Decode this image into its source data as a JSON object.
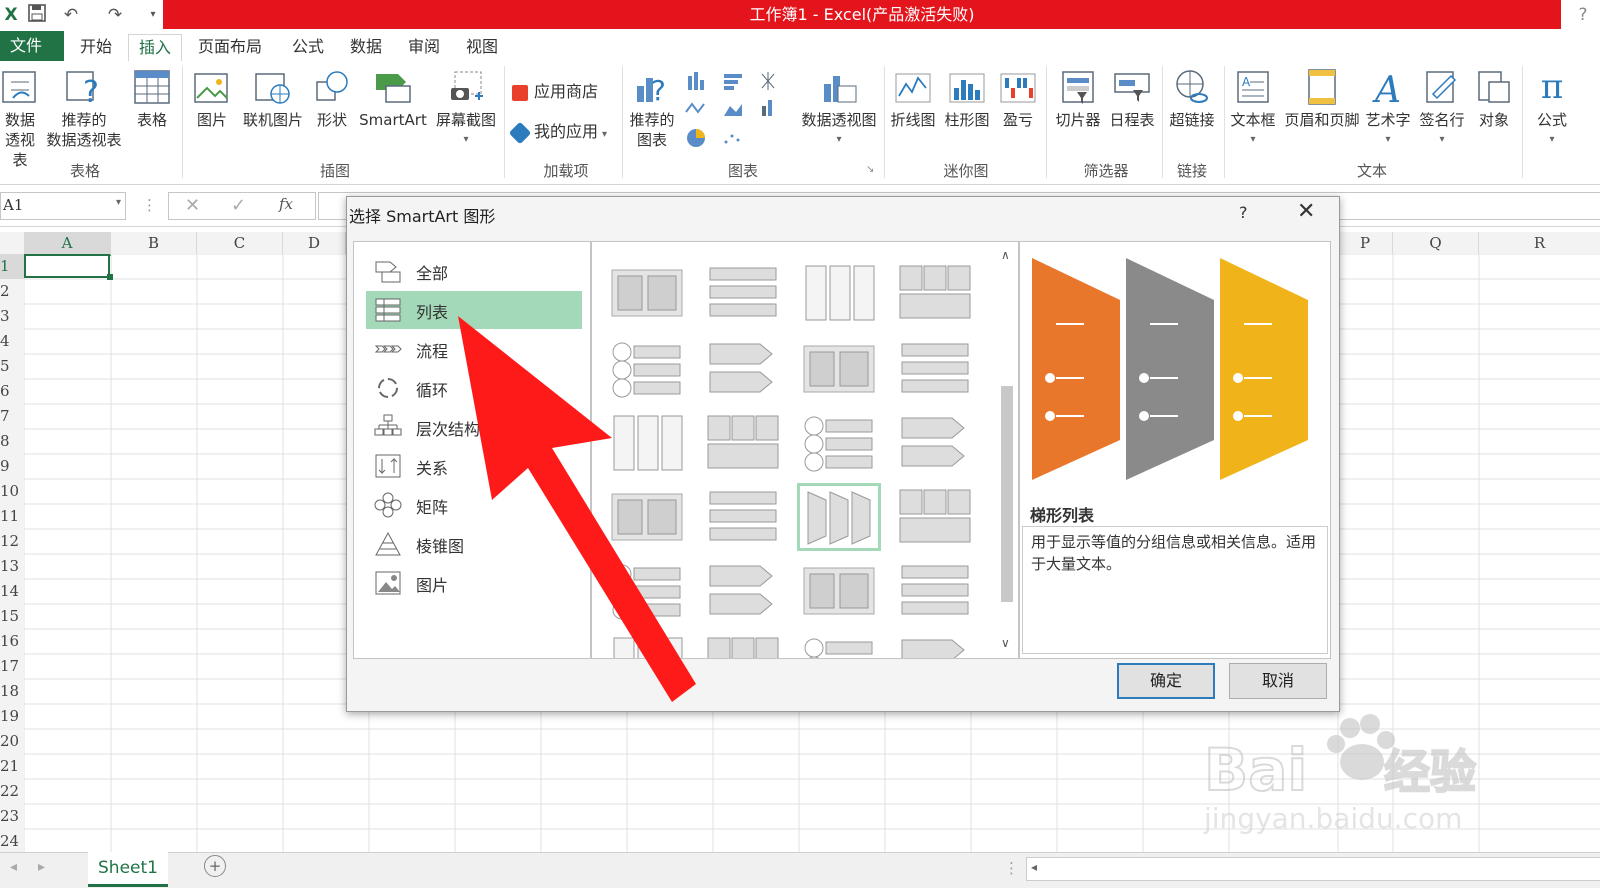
{
  "app": {
    "title": "工作簿1 - Excel(产品激活失败)",
    "help": "?"
  },
  "tabs": [
    "文件",
    "开始",
    "插入",
    "页面布局",
    "公式",
    "数据",
    "审阅",
    "视图"
  ],
  "ribbon": {
    "tables_group": {
      "label": "表格",
      "btn1_a": "数据",
      "btn1_b": "透视表",
      "btn2_a": "推荐的",
      "btn2_b": "数据透视表",
      "btn3": "表格"
    },
    "illustrations_group": {
      "label": "插图",
      "picture": "图片",
      "online_picture": "联机图片",
      "shapes": "形状",
      "smartart": "SmartArt",
      "screenshot": "屏幕截图"
    },
    "addins_group": {
      "label": "加载项",
      "store": "应用商店",
      "my_apps": "我的应用"
    },
    "charts_group": {
      "label": "图表",
      "recommended_a": "推荐的",
      "recommended_b": "图表",
      "pivot_chart": "数据透视图"
    },
    "sparklines_group": {
      "label": "迷你图",
      "line": "折线图",
      "column": "柱形图",
      "win_loss": "盈亏"
    },
    "filters_group": {
      "label": "筛选器",
      "slicer": "切片器",
      "timeline": "日程表"
    },
    "links_group": {
      "label": "链接",
      "hyperlink": "超链接"
    },
    "text_group": {
      "label": "文本",
      "textbox": "文本框",
      "header_footer": "页眉和页脚",
      "wordart": "艺术字",
      "signature": "签名行",
      "object": "对象"
    },
    "symbols_group": {
      "equation": "公式"
    }
  },
  "formula_bar": {
    "name_box": "A1",
    "fx": "fx"
  },
  "columns": [
    "A",
    "B",
    "C",
    "D",
    "P",
    "Q",
    "R"
  ],
  "rows": [
    "1",
    "2",
    "3",
    "4",
    "5",
    "6",
    "7",
    "8",
    "9",
    "10",
    "11",
    "12",
    "13",
    "14",
    "15",
    "16",
    "17",
    "18",
    "19",
    "20",
    "21",
    "22",
    "23",
    "24"
  ],
  "sheet": {
    "tab": "Sheet1"
  },
  "dialog": {
    "title": "选择 SmartArt 图形",
    "help": "?",
    "categories": [
      {
        "label": "全部",
        "icon": "all-icon"
      },
      {
        "label": "列表",
        "icon": "list-icon"
      },
      {
        "label": "流程",
        "icon": "process-icon"
      },
      {
        "label": "循环",
        "icon": "cycle-icon"
      },
      {
        "label": "层次结构",
        "icon": "hierarchy-icon"
      },
      {
        "label": "关系",
        "icon": "relationship-icon"
      },
      {
        "label": "矩阵",
        "icon": "matrix-icon"
      },
      {
        "label": "棱锥图",
        "icon": "pyramid-icon"
      },
      {
        "label": "图片",
        "icon": "picture-icon"
      }
    ],
    "selected_category": "列表",
    "preview": {
      "name": "梯形列表",
      "description": "用于显示等值的分组信息或相关信息。适用于大量文本。",
      "colors": [
        "#e8762b",
        "#8a8a8a",
        "#f0b31a"
      ]
    },
    "ok": "确定",
    "cancel": "取消"
  },
  "accent": {
    "excel_green": "#217346",
    "title_red": "#e3141c",
    "arrow_red": "#ff1a1a",
    "selection_green": "#a3d9b9"
  },
  "watermark": {
    "brand": "Bai",
    "brand_cn": "经验",
    "url": "jingyan.baidu.com"
  }
}
